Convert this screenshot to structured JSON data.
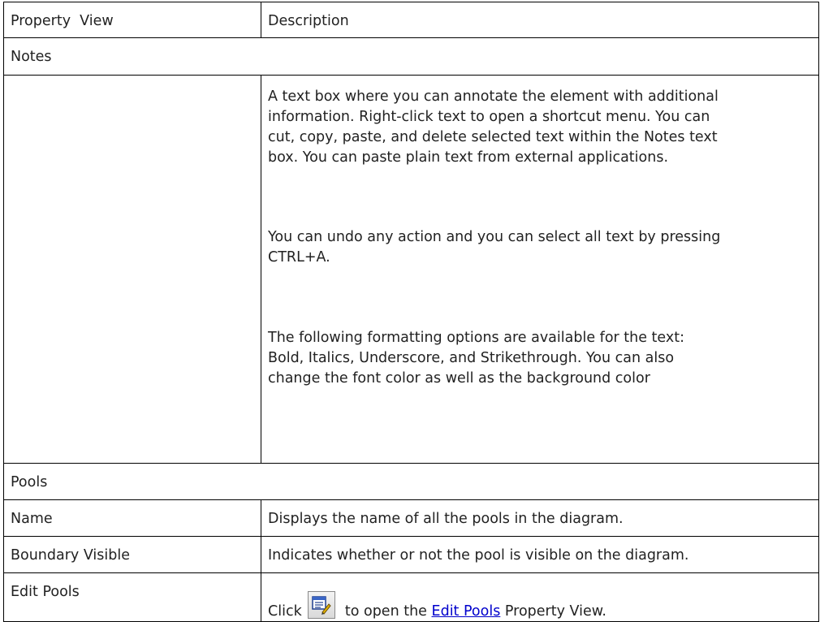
{
  "header": {
    "col1": "Property  View",
    "col2": "Description"
  },
  "notes": {
    "section_label": "Notes",
    "para1_lines": [
      "A text box where you can annotate the element with additional",
      "information. Right-click text to open a shortcut menu. You can",
      "cut, copy, paste, and delete selected text within the Notes text",
      "box. You can paste plain text from external applications."
    ],
    "para2_lines": [
      "You can undo any action and you can select all text by pressing",
      "CTRL+A."
    ],
    "para3_lines": [
      "The following formatting options are available for the text:",
      "Bold, Italics, Underscore, and Strikethrough. You can also",
      "change the font color as well as the background color"
    ]
  },
  "pools": {
    "section_label": "Pools",
    "rows": [
      {
        "property": "Name",
        "description": "Displays the name of all the pools in the diagram."
      },
      {
        "property": "Boundary Visible",
        "description": "Indicates whether or not the pool is visible on the diagram."
      }
    ],
    "edit_pools": {
      "property": "Edit Pools",
      "click_text": "Click",
      "mid_text": "to open the",
      "link_text": "Edit Pools",
      "end_text": "Property View.",
      "button_icon": "edit-properties-icon"
    }
  }
}
